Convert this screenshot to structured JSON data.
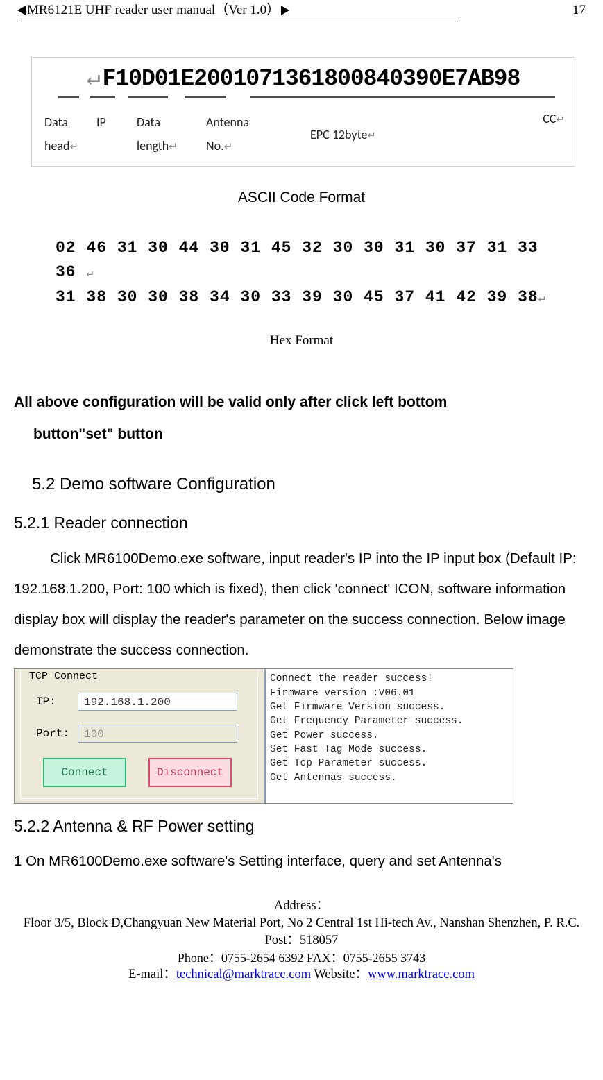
{
  "header": {
    "title": "MR6121E UHF reader user manual（Ver 1.0）",
    "page_number": "17"
  },
  "ascii_figure": {
    "prefix_mark": "↵",
    "code": "F10D01E2001071361800840390E7AB98",
    "labels": {
      "data_head": "Data head",
      "ip": "IP",
      "data_length": "Data length",
      "antenna_no": "Antenna No.",
      "epc": "EPC 12byte",
      "cc": "CC"
    },
    "return_glyph": "↵",
    "caption": "ASCII Code Format"
  },
  "hex_figure": {
    "line1": "02 46 31 30 44 30 31 45 32 30 30 31 30 37 31 33 36 ",
    "line2": "31 38 30 30 38 34 30 33 39 30 45 37 41 42 39 38",
    "return_glyph": "↵",
    "caption": "Hex Format"
  },
  "note": {
    "line1": "All above configuration   will be valid   only after click left bottom",
    "line2": "button\"set\" button"
  },
  "section_5_2": "5.2 Demo software Configuration",
  "section_5_2_1": {
    "heading": "5.2.1 Reader connection",
    "body": "Click MR6100Demo.exe software, input reader's IP into the IP input box (Default IP: 192.168.1.200, Port: 100 which is fixed), then click 'connect' ICON, software information display box will display the reader's parameter on the success connection. Below image demonstrate the success connection."
  },
  "demo_figure": {
    "group_label": "TCP Connect",
    "ip_label": "IP:",
    "ip_value": "192.168.1.200",
    "port_label": "Port:",
    "port_value": "100",
    "connect_btn": "Connect",
    "disconnect_btn": "Disconnect",
    "log_lines": [
      "Connect the reader success!",
      "Firmware version :V06.01",
      "Get Firmware Version success.",
      "Get Frequency Parameter success.",
      "Get Power success.",
      "Set  Fast Tag Mode success.",
      "Get Tcp Parameter success.",
      "Get Antennas success."
    ]
  },
  "section_5_2_2": {
    "heading": "5.2.2 Antenna & RF Power setting",
    "body": "1 On MR6100Demo.exe software's Setting interface, query and set Antenna's"
  },
  "footer": {
    "address_label": "Address：",
    "address_line": "Floor 3/5, Block D,Changyuan New  Material Port, No 2 Central 1st Hi-tech Av., Nanshan Shenzhen, P. R.C.   Post：518057",
    "phone_line": "Phone：0755-2654 6392   FAX：0755-2655 3743",
    "email_label": "E-mail：",
    "email": "technical@marktrace.com",
    "website_label": "     Website：",
    "website": "www.marktrace.com"
  }
}
